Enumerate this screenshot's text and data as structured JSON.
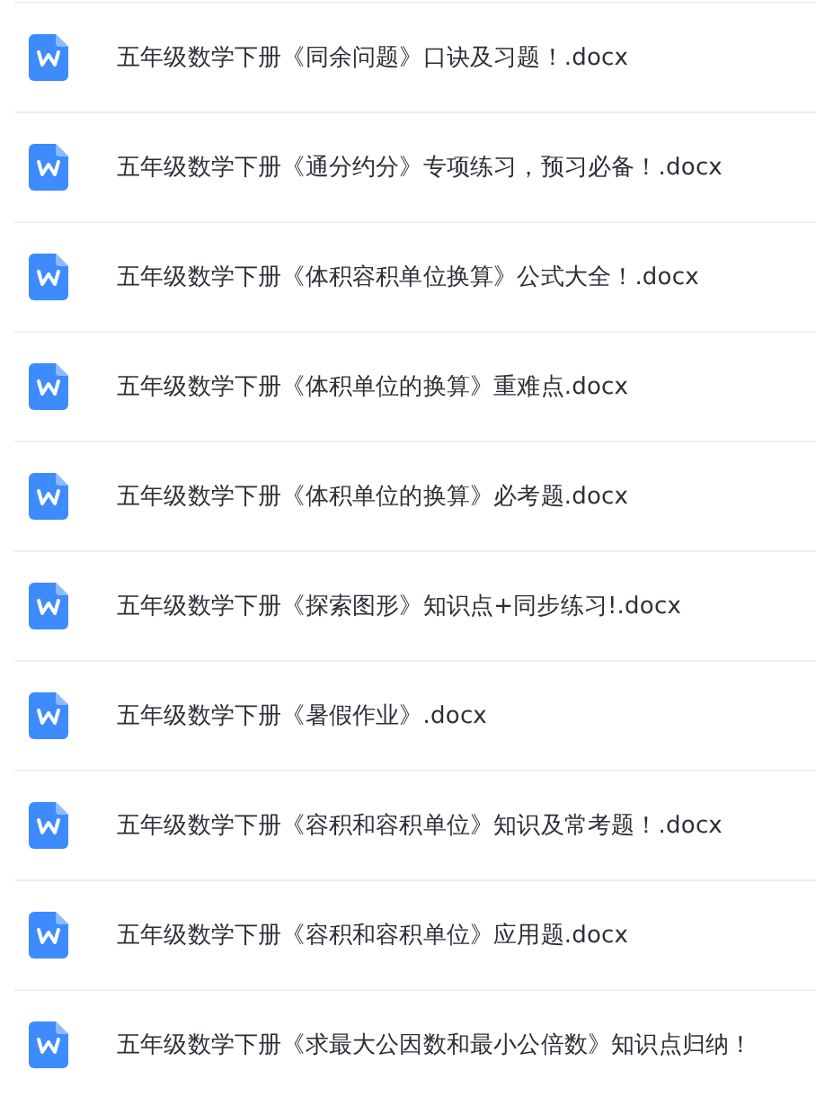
{
  "files": [
    {
      "name": "五年级数学下册《同余问题》口诀及习题！.docx"
    },
    {
      "name": "五年级数学下册《通分约分》专项练习，预习必备！.docx"
    },
    {
      "name": "五年级数学下册《体积容积单位换算》公式大全！.docx"
    },
    {
      "name": "五年级数学下册《体积单位的换算》重难点.docx"
    },
    {
      "name": "五年级数学下册《体积单位的换算》必考题.docx"
    },
    {
      "name": "五年级数学下册《探索图形》知识点+同步练习!.docx"
    },
    {
      "name": "五年级数学下册《暑假作业》.docx"
    },
    {
      "name": "五年级数学下册《容积和容积单位》知识及常考题！.docx"
    },
    {
      "name": "五年级数学下册《容积和容积单位》应用题.docx"
    },
    {
      "name": "五年级数学下册《求最大公因数和最小公倍数》知识点归纳！"
    }
  ]
}
